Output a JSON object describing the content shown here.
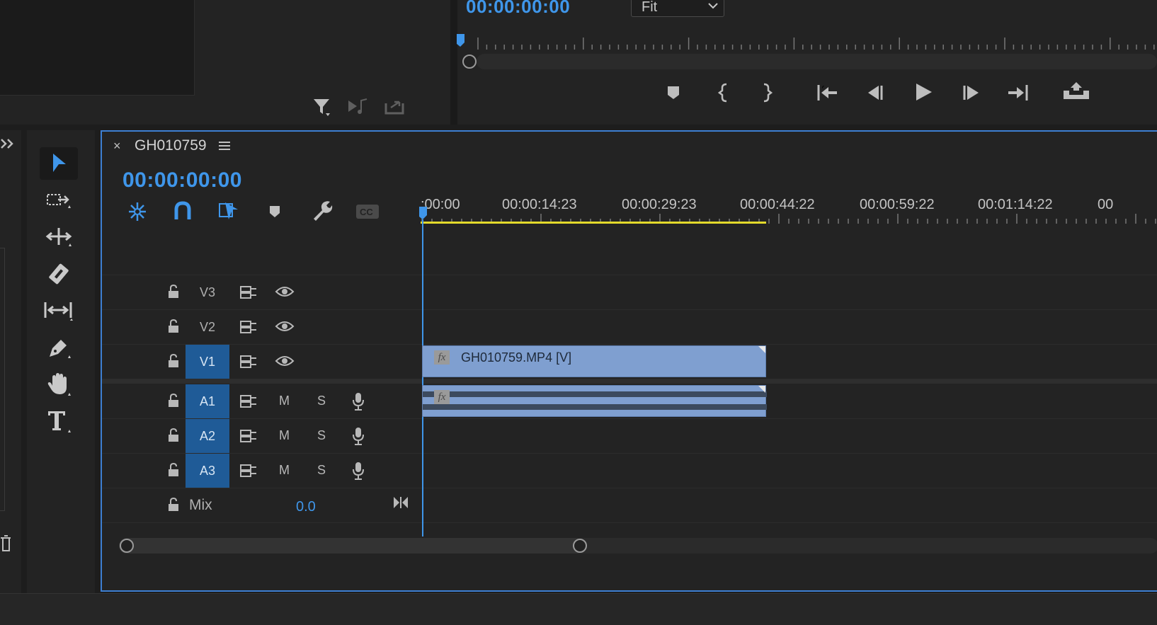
{
  "project_panel": {
    "icons": [
      "filter-icon",
      "insert-audio-icon",
      "export-icon"
    ]
  },
  "program_monitor": {
    "timecode": "00:00:00:00",
    "zoom_select": "Fit",
    "controls": [
      "add-marker-icon",
      "mark-in-icon",
      "mark-out-icon",
      "go-to-in-icon",
      "step-back-icon",
      "play-icon",
      "step-forward-icon",
      "go-to-out-icon",
      "lift-icon"
    ]
  },
  "timeline": {
    "sequence_name": "GH010759",
    "timecode": "00:00:00:00",
    "ruler_labels": [
      ":00:00",
      "00:00:14:23",
      "00:00:29:23",
      "00:00:44:22",
      "00:00:59:22",
      "00:01:14:22",
      "00"
    ],
    "video_tracks": [
      {
        "name": "V3",
        "active": false
      },
      {
        "name": "V2",
        "active": false
      },
      {
        "name": "V1",
        "active": true
      }
    ],
    "audio_tracks": [
      {
        "name": "A1",
        "mute": "M",
        "solo": "S"
      },
      {
        "name": "A2",
        "mute": "M",
        "solo": "S"
      },
      {
        "name": "A3",
        "mute": "M",
        "solo": "S"
      }
    ],
    "mix": {
      "label": "Mix",
      "value": "0.0"
    },
    "clip": {
      "video_label": "GH010759.MP4 [V]",
      "fx_badge": "fx"
    }
  },
  "tools": [
    "selection-tool",
    "track-select-tool",
    "ripple-edit-tool",
    "razor-tool",
    "slip-tool",
    "pen-tool",
    "hand-tool",
    "type-tool"
  ],
  "colors": {
    "accent": "#3f96ea",
    "clip": "#7f9fd0",
    "work_area": "#e3d92b",
    "panel_border": "#3d7fd2"
  }
}
